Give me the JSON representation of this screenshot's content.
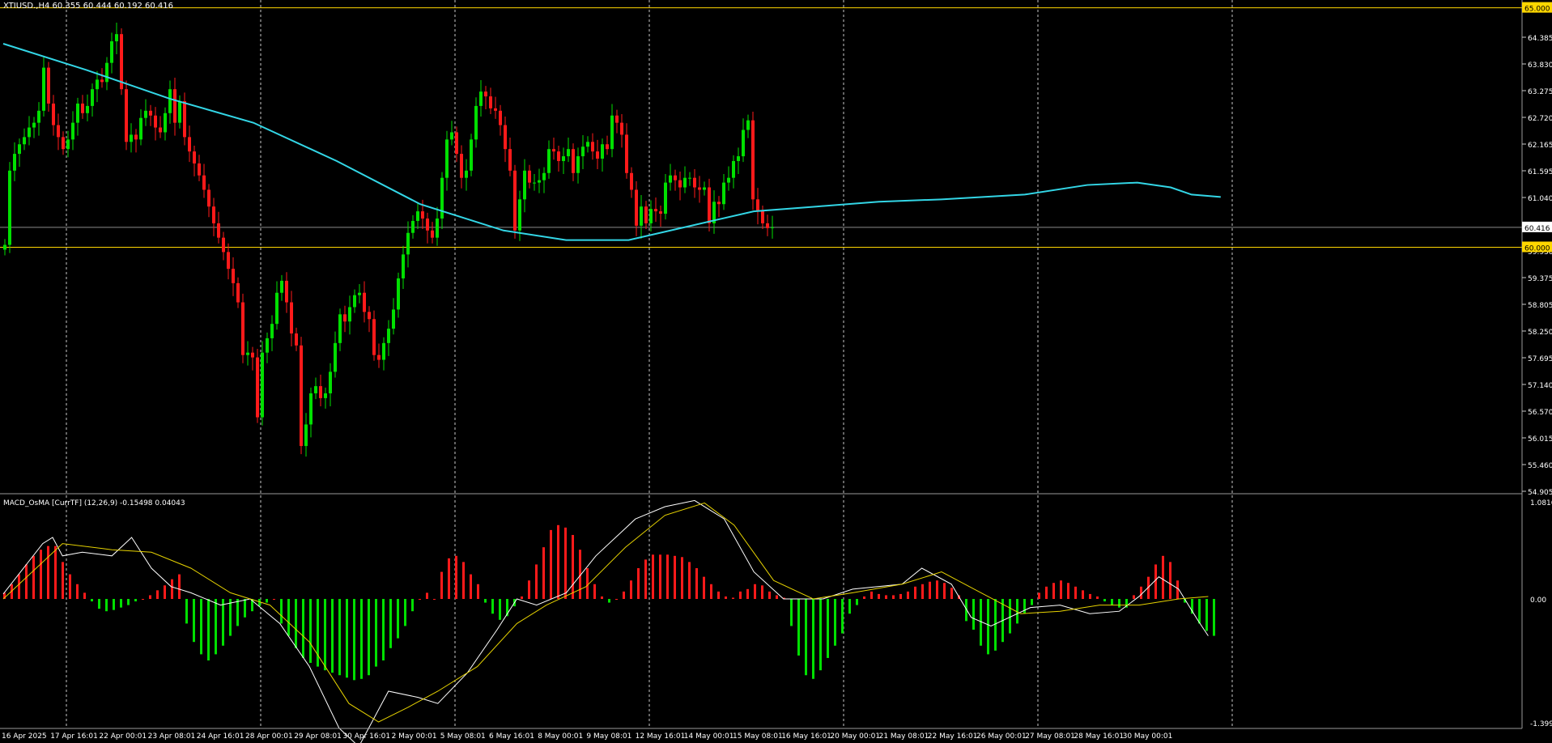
{
  "main_header": "XTIUSD.,H4  60.355 60.444 60.192 60.416",
  "sub_header": "MACD_OsMA [CurrTF] (12,26,9) -0.15498 0.04043",
  "colors": {
    "background": "#000000",
    "grid": "#c8c8c8",
    "bull": "#00e000",
    "bear": "#ff1a1a",
    "ma": "#33d6e6",
    "level": "#ffd700",
    "axis_text": "#ffffff",
    "macd_line": "#ffffff",
    "signal_line": "#e6d200"
  },
  "chart_data": [
    {
      "type": "candlestick",
      "symbol": "XTIUSD.",
      "timeframe": "H4",
      "ohlc_last": {
        "open": 60.355,
        "high": 60.444,
        "low": 60.192,
        "close": 60.416
      },
      "ylim": [
        54.905,
        65.6
      ],
      "y_ticks": [
        "64.385",
        "63.830",
        "63.275",
        "62.720",
        "62.165",
        "61.595",
        "61.040",
        "60.485",
        "59.930",
        "59.375",
        "58.805",
        "58.250",
        "57.695",
        "57.140",
        "56.570",
        "56.015",
        "55.460",
        "54.905"
      ],
      "levels": [
        {
          "label": "65.000",
          "value": 65.0
        },
        {
          "label": "60.000",
          "value": 60.0
        }
      ],
      "current_price_label": "60.416",
      "x_labels": [
        "16 Apr 2025",
        "17 Apr 16:01",
        "22 Apr 00:01",
        "23 Apr 08:01",
        "24 Apr 16:01",
        "28 Apr 00:01",
        "29 Apr 08:01",
        "30 Apr 16:01",
        "2 May 00:01",
        "5 May 08:01",
        "6 May 16:01",
        "8 May 00:01",
        "9 May 08:01",
        "12 May 16:01",
        "14 May 00:01",
        "15 May 08:01",
        "16 May 16:01",
        "20 May 00:01",
        "21 May 08:01",
        "22 May 16:01",
        "26 May 00:01",
        "27 May 08:01",
        "28 May 16:01",
        "30 May 00:01"
      ],
      "closes": [
        60.05,
        61.6,
        61.95,
        62.15,
        62.3,
        62.5,
        62.6,
        62.85,
        63.75,
        63.0,
        62.55,
        62.3,
        62.05,
        62.25,
        62.6,
        63.0,
        62.8,
        62.95,
        63.3,
        63.5,
        63.45,
        63.85,
        64.3,
        64.45,
        63.3,
        62.2,
        62.35,
        62.25,
        62.7,
        62.85,
        62.75,
        62.5,
        62.4,
        62.8,
        63.3,
        62.6,
        63.05,
        62.3,
        62.0,
        61.75,
        61.5,
        61.2,
        60.85,
        60.5,
        60.2,
        59.9,
        59.55,
        59.25,
        58.85,
        57.75,
        57.8,
        57.7,
        56.45,
        57.8,
        58.1,
        58.4,
        59.05,
        59.3,
        58.85,
        58.2,
        57.95,
        55.85,
        56.3,
        56.95,
        57.1,
        56.85,
        56.95,
        57.4,
        58.0,
        58.6,
        58.45,
        58.75,
        59.0,
        59.05,
        58.65,
        58.5,
        57.75,
        57.65,
        58.0,
        58.3,
        58.7,
        59.35,
        59.85,
        60.3,
        60.55,
        60.75,
        60.6,
        60.35,
        60.2,
        60.6,
        61.45,
        62.25,
        62.4,
        61.95,
        61.45,
        61.6,
        62.25,
        62.95,
        63.25,
        63.15,
        62.9,
        62.85,
        62.55,
        62.05,
        61.6,
        60.35,
        61.0,
        61.6,
        61.35,
        61.35,
        61.4,
        61.55,
        62.05,
        62.0,
        61.8,
        61.9,
        62.05,
        61.55,
        61.9,
        62.1,
        62.2,
        62.0,
        61.85,
        62.15,
        62.05,
        62.75,
        62.6,
        62.35,
        61.55,
        61.2,
        60.45,
        60.85,
        60.5,
        60.8,
        60.75,
        60.7,
        61.35,
        61.5,
        61.4,
        61.25,
        61.45,
        61.45,
        61.25,
        61.2,
        61.25,
        60.5,
        60.95,
        60.9,
        61.35,
        61.45,
        61.8,
        61.9,
        62.45,
        62.65,
        61.0,
        60.75,
        60.5,
        60.4,
        60.416
      ],
      "moving_average": {
        "period_hint": "long MA",
        "points": [
          [
            0,
            64.25
          ],
          [
            20,
            63.7
          ],
          [
            40,
            63.1
          ],
          [
            60,
            62.6
          ],
          [
            80,
            61.8
          ],
          [
            100,
            60.9
          ],
          [
            120,
            60.35
          ],
          [
            135,
            60.15
          ],
          [
            150,
            60.15
          ],
          [
            165,
            60.45
          ],
          [
            180,
            60.75
          ],
          [
            195,
            60.85
          ],
          [
            210,
            60.95
          ],
          [
            225,
            61.0
          ],
          [
            245,
            61.1
          ],
          [
            260,
            61.3
          ],
          [
            272,
            61.35
          ],
          [
            280,
            61.25
          ],
          [
            285,
            61.1
          ],
          [
            292,
            61.05
          ]
        ]
      }
    },
    {
      "type": "histogram",
      "indicator": "MACD_OsMA [CurrTF] (12,26,9)",
      "values_label": "-0.15498 0.04043",
      "ylim": [
        -1.39953,
        1.08169
      ],
      "y_ticks": [
        "1.08169",
        "0.00",
        "-1.39953"
      ],
      "osma": [
        0.05,
        0.12,
        0.2,
        0.28,
        0.35,
        0.4,
        0.43,
        0.43,
        0.3,
        0.2,
        0.12,
        0.05,
        -0.02,
        -0.08,
        -0.1,
        -0.09,
        -0.07,
        -0.05,
        -0.02,
        0.0,
        0.03,
        0.07,
        0.11,
        0.16,
        0.2,
        -0.2,
        -0.35,
        -0.45,
        -0.5,
        -0.45,
        -0.38,
        -0.3,
        -0.22,
        -0.15,
        -0.1,
        -0.06,
        -0.03,
        0.0,
        -0.2,
        -0.3,
        -0.4,
        -0.48,
        -0.52,
        -0.55,
        -0.58,
        -0.6,
        -0.62,
        -0.64,
        -0.66,
        -0.65,
        -0.62,
        -0.55,
        -0.5,
        -0.4,
        -0.32,
        -0.22,
        -0.1,
        0.0,
        0.05,
        0.0,
        0.22,
        0.33,
        0.35,
        0.3,
        0.2,
        0.12,
        -0.03,
        -0.12,
        -0.17,
        -0.14,
        -0.06,
        0.02,
        0.15,
        0.28,
        0.42,
        0.56,
        0.6,
        0.58,
        0.52,
        0.4,
        0.25,
        0.12,
        0.02,
        -0.03,
        0.0,
        0.06,
        0.15,
        0.25,
        0.32,
        0.36,
        0.36,
        0.36,
        0.35,
        0.34,
        0.3,
        0.25,
        0.18,
        0.12,
        0.06,
        0.02,
        0.01,
        0.06,
        0.08,
        0.12,
        0.11,
        0.06,
        0.03,
        0.01,
        -0.22,
        -0.46,
        -0.62,
        -0.65,
        -0.58,
        -0.48,
        -0.38,
        -0.28,
        -0.12,
        -0.05,
        0.02,
        0.06,
        0.04,
        0.03,
        0.03,
        0.04,
        0.06,
        0.1,
        0.12,
        0.14,
        0.15,
        0.13,
        0.09,
        0.03,
        -0.18,
        -0.25,
        -0.38,
        -0.45,
        -0.42,
        -0.35,
        -0.28,
        -0.2,
        -0.12,
        -0.05,
        0.05,
        0.1,
        0.13,
        0.15,
        0.13,
        0.1,
        0.07,
        0.04,
        0.02,
        -0.02,
        -0.05,
        -0.07,
        -0.07,
        0.03,
        0.1,
        0.18,
        0.28,
        0.35,
        0.3,
        0.15,
        -0.03,
        -0.12,
        -0.2,
        -0.26,
        -0.3
      ],
      "macd": [
        [
          0,
          0.04
        ],
        [
          8,
          0.45
        ],
        [
          10,
          0.5
        ],
        [
          12,
          0.35
        ],
        [
          16,
          0.38
        ],
        [
          22,
          0.35
        ],
        [
          26,
          0.5
        ],
        [
          30,
          0.25
        ],
        [
          34,
          0.1
        ],
        [
          38,
          0.05
        ],
        [
          44,
          -0.05
        ],
        [
          50,
          0.0
        ],
        [
          56,
          -0.2
        ],
        [
          62,
          -0.55
        ],
        [
          68,
          -1.05
        ],
        [
          72,
          -1.2
        ],
        [
          74,
          -1.05
        ],
        [
          78,
          -0.75
        ],
        [
          84,
          -0.8
        ],
        [
          88,
          -0.85
        ],
        [
          94,
          -0.6
        ],
        [
          100,
          -0.25
        ],
        [
          104,
          0.0
        ],
        [
          108,
          -0.05
        ],
        [
          114,
          0.05
        ],
        [
          120,
          0.35
        ],
        [
          128,
          0.65
        ],
        [
          134,
          0.75
        ],
        [
          140,
          0.8
        ],
        [
          146,
          0.65
        ],
        [
          152,
          0.22
        ],
        [
          158,
          0.0
        ],
        [
          166,
          0.0
        ],
        [
          172,
          0.08
        ],
        [
          182,
          0.12
        ],
        [
          186,
          0.25
        ],
        [
          192,
          0.12
        ],
        [
          196,
          -0.15
        ],
        [
          200,
          -0.22
        ],
        [
          208,
          -0.07
        ],
        [
          214,
          -0.05
        ],
        [
          220,
          -0.12
        ],
        [
          226,
          -0.1
        ],
        [
          230,
          0.02
        ],
        [
          234,
          0.18
        ],
        [
          238,
          0.08
        ],
        [
          242,
          -0.18
        ],
        [
          244,
          -0.3
        ]
      ],
      "signal": [
        [
          0,
          0.0
        ],
        [
          12,
          0.45
        ],
        [
          22,
          0.4
        ],
        [
          30,
          0.38
        ],
        [
          38,
          0.25
        ],
        [
          46,
          0.05
        ],
        [
          54,
          -0.05
        ],
        [
          62,
          -0.35
        ],
        [
          70,
          -0.85
        ],
        [
          76,
          -1.0
        ],
        [
          82,
          -0.88
        ],
        [
          88,
          -0.75
        ],
        [
          96,
          -0.55
        ],
        [
          104,
          -0.2
        ],
        [
          110,
          -0.05
        ],
        [
          118,
          0.1
        ],
        [
          126,
          0.42
        ],
        [
          134,
          0.68
        ],
        [
          142,
          0.78
        ],
        [
          148,
          0.6
        ],
        [
          156,
          0.15
        ],
        [
          164,
          0.0
        ],
        [
          172,
          0.05
        ],
        [
          182,
          0.12
        ],
        [
          190,
          0.22
        ],
        [
          198,
          0.05
        ],
        [
          206,
          -0.12
        ],
        [
          214,
          -0.1
        ],
        [
          222,
          -0.05
        ],
        [
          230,
          -0.05
        ],
        [
          238,
          0.0
        ],
        [
          244,
          0.02
        ]
      ]
    }
  ]
}
